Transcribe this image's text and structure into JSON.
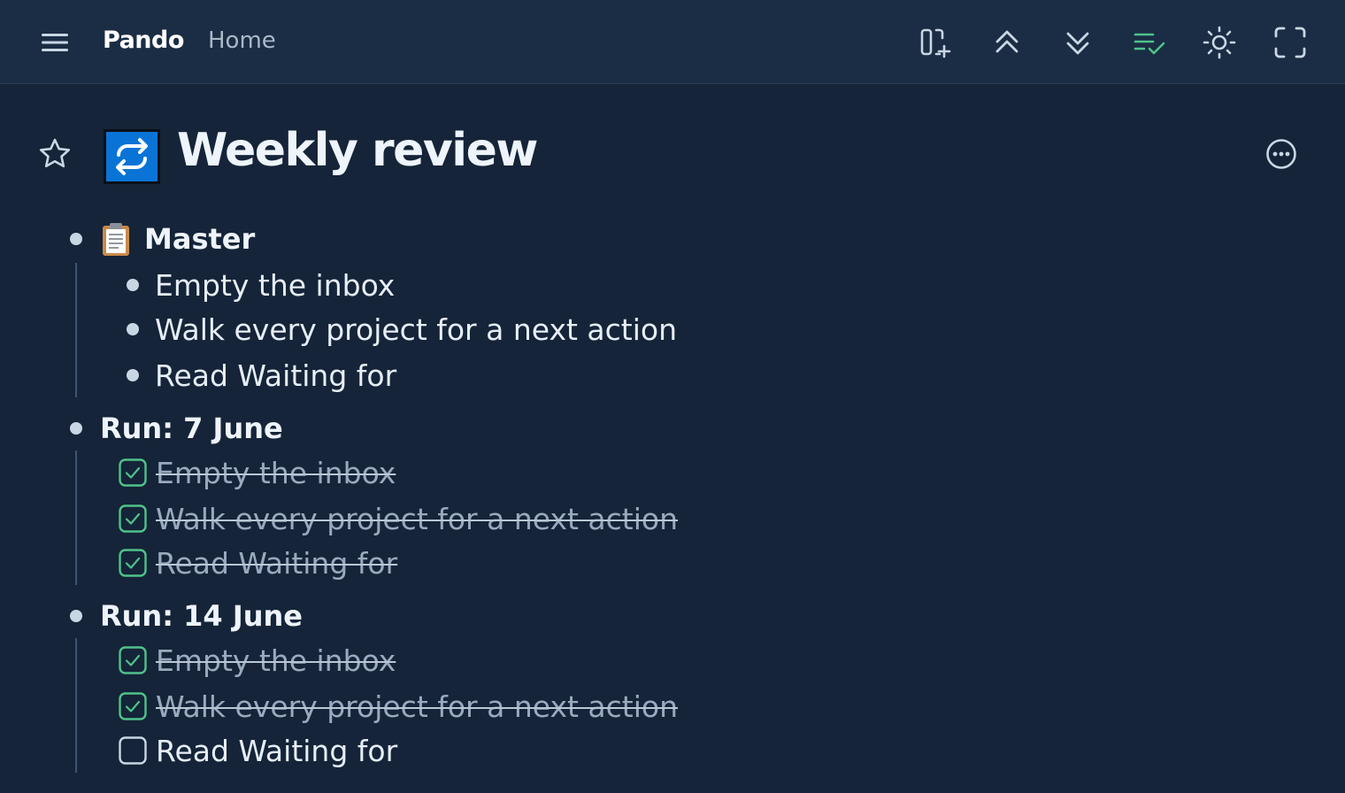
{
  "app": {
    "brand": "Pando",
    "breadcrumb": "Home"
  },
  "toolbar": {
    "icons": [
      "add-panel-icon",
      "collapse-all-icon",
      "expand-all-icon",
      "show-completed-icon",
      "theme-icon",
      "fullscreen-icon"
    ],
    "accent": "#4fc28a"
  },
  "page": {
    "title": "Weekly review",
    "icon": "repeat-icon",
    "icon_color": "#0a74d6"
  },
  "tree": {
    "master": {
      "label": "Master",
      "emoji": "clipboard-icon",
      "items": [
        "Empty the inbox",
        "Walk every project for a next action",
        "Read Waiting for"
      ]
    },
    "run1": {
      "label": "Run: 7 June",
      "items": [
        {
          "text": "Empty the inbox",
          "done": true
        },
        {
          "text": "Walk every project for a next action",
          "done": true
        },
        {
          "text": "Read Waiting for",
          "done": true
        }
      ]
    },
    "run2": {
      "label": "Run: 14 June",
      "items": [
        {
          "text": "Empty the inbox",
          "done": true
        },
        {
          "text": "Walk every project for a next action",
          "done": true
        },
        {
          "text": "Read Waiting for",
          "done": false
        }
      ]
    }
  },
  "colors": {
    "background": "#152438",
    "topbar": "#1a2d44",
    "check_done": "#4fc28a"
  }
}
